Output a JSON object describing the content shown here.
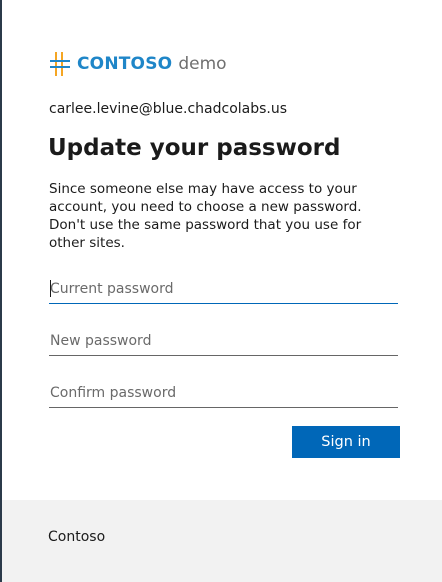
{
  "branding": {
    "logo_icon": "contoso-logo-icon",
    "brand_name": "CONTOSO",
    "brand_suffix": "demo",
    "brand_color": "#1f86c8",
    "accent_color": "#f5a623"
  },
  "identity": {
    "email": "carlee.levine@blue.chadcolabs.us"
  },
  "form": {
    "title": "Update your password",
    "description": "Since someone else may have access to your account, you need to choose a new password. Don't use the same password that you use for other sites.",
    "fields": {
      "current_password": {
        "value": "",
        "placeholder": "Current password"
      },
      "new_password": {
        "value": "",
        "placeholder": "New password"
      },
      "confirm_password": {
        "value": "",
        "placeholder": "Confirm password"
      }
    },
    "submit_label": "Sign in",
    "submit_color": "#0067b8"
  },
  "footer": {
    "text": "Contoso"
  }
}
